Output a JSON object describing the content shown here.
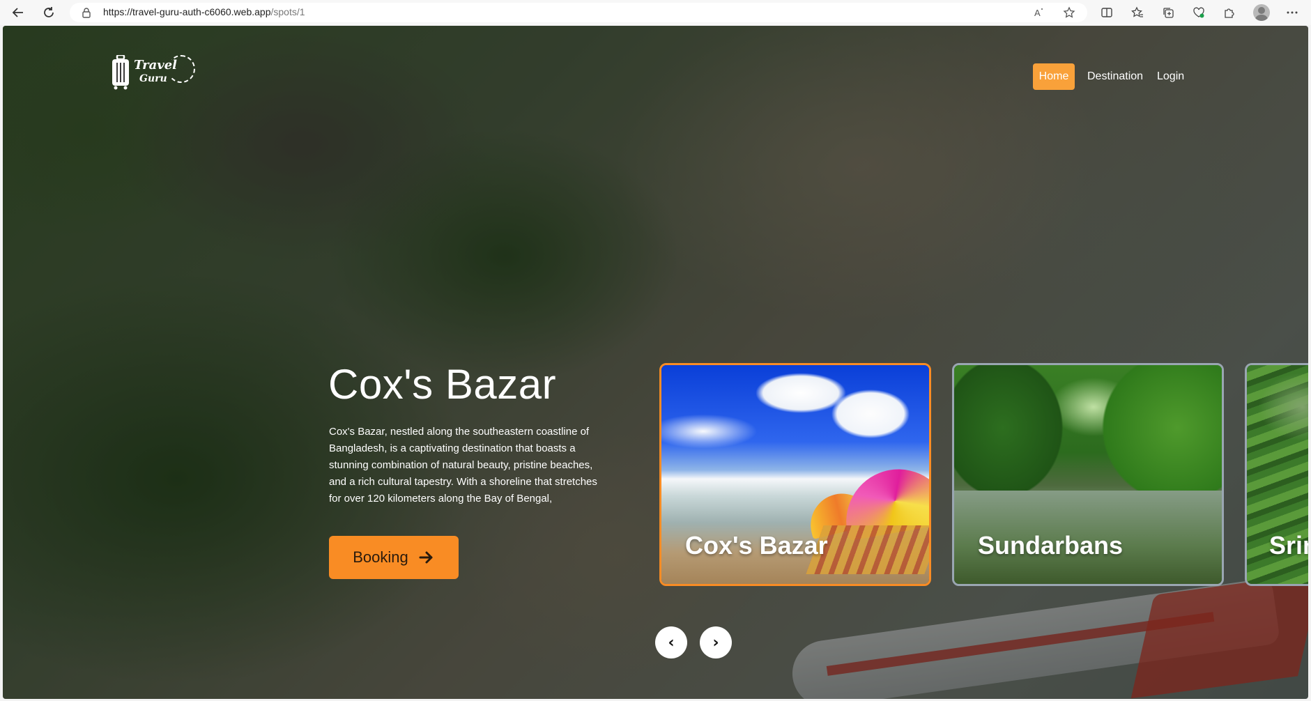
{
  "browser": {
    "url_host": "https://travel-guru-auth-c6060.web.app",
    "url_path": "/spots/1",
    "icons": [
      "back-icon",
      "refresh-icon",
      "lock-icon",
      "read-aloud-icon",
      "favorite-star-icon",
      "split-screen-icon",
      "favorites-icon",
      "collections-icon",
      "browser-essentials-icon",
      "extensions-icon",
      "profile-avatar",
      "more-icon"
    ]
  },
  "header": {
    "logo": {
      "line1": "Travel",
      "line2": "Guru"
    },
    "nav": [
      {
        "label": "Home",
        "active": true
      },
      {
        "label": "Destination",
        "active": false
      },
      {
        "label": "Login",
        "active": false
      }
    ]
  },
  "hero": {
    "title": "Cox's Bazar",
    "description": "Cox's Bazar, nestled along the southeastern coastline of Bangladesh, is a captivating destination that boasts a stunning combination of natural beauty, pristine beaches, and a rich cultural tapestry. With a shoreline that stretches for over 120 kilometers along the Bay of Bengal,",
    "booking_label": "Booking"
  },
  "cards": [
    {
      "label": "Cox's Bazar",
      "active": true
    },
    {
      "label": "Sundarbans",
      "active": false
    },
    {
      "label": "Srimangal",
      "active": false
    }
  ],
  "carousel": {
    "prev": "‹",
    "next": "›"
  },
  "colors": {
    "accent": "#f98c24",
    "nav_active": "#f9a13a",
    "card_border": "#9aa6b2"
  }
}
